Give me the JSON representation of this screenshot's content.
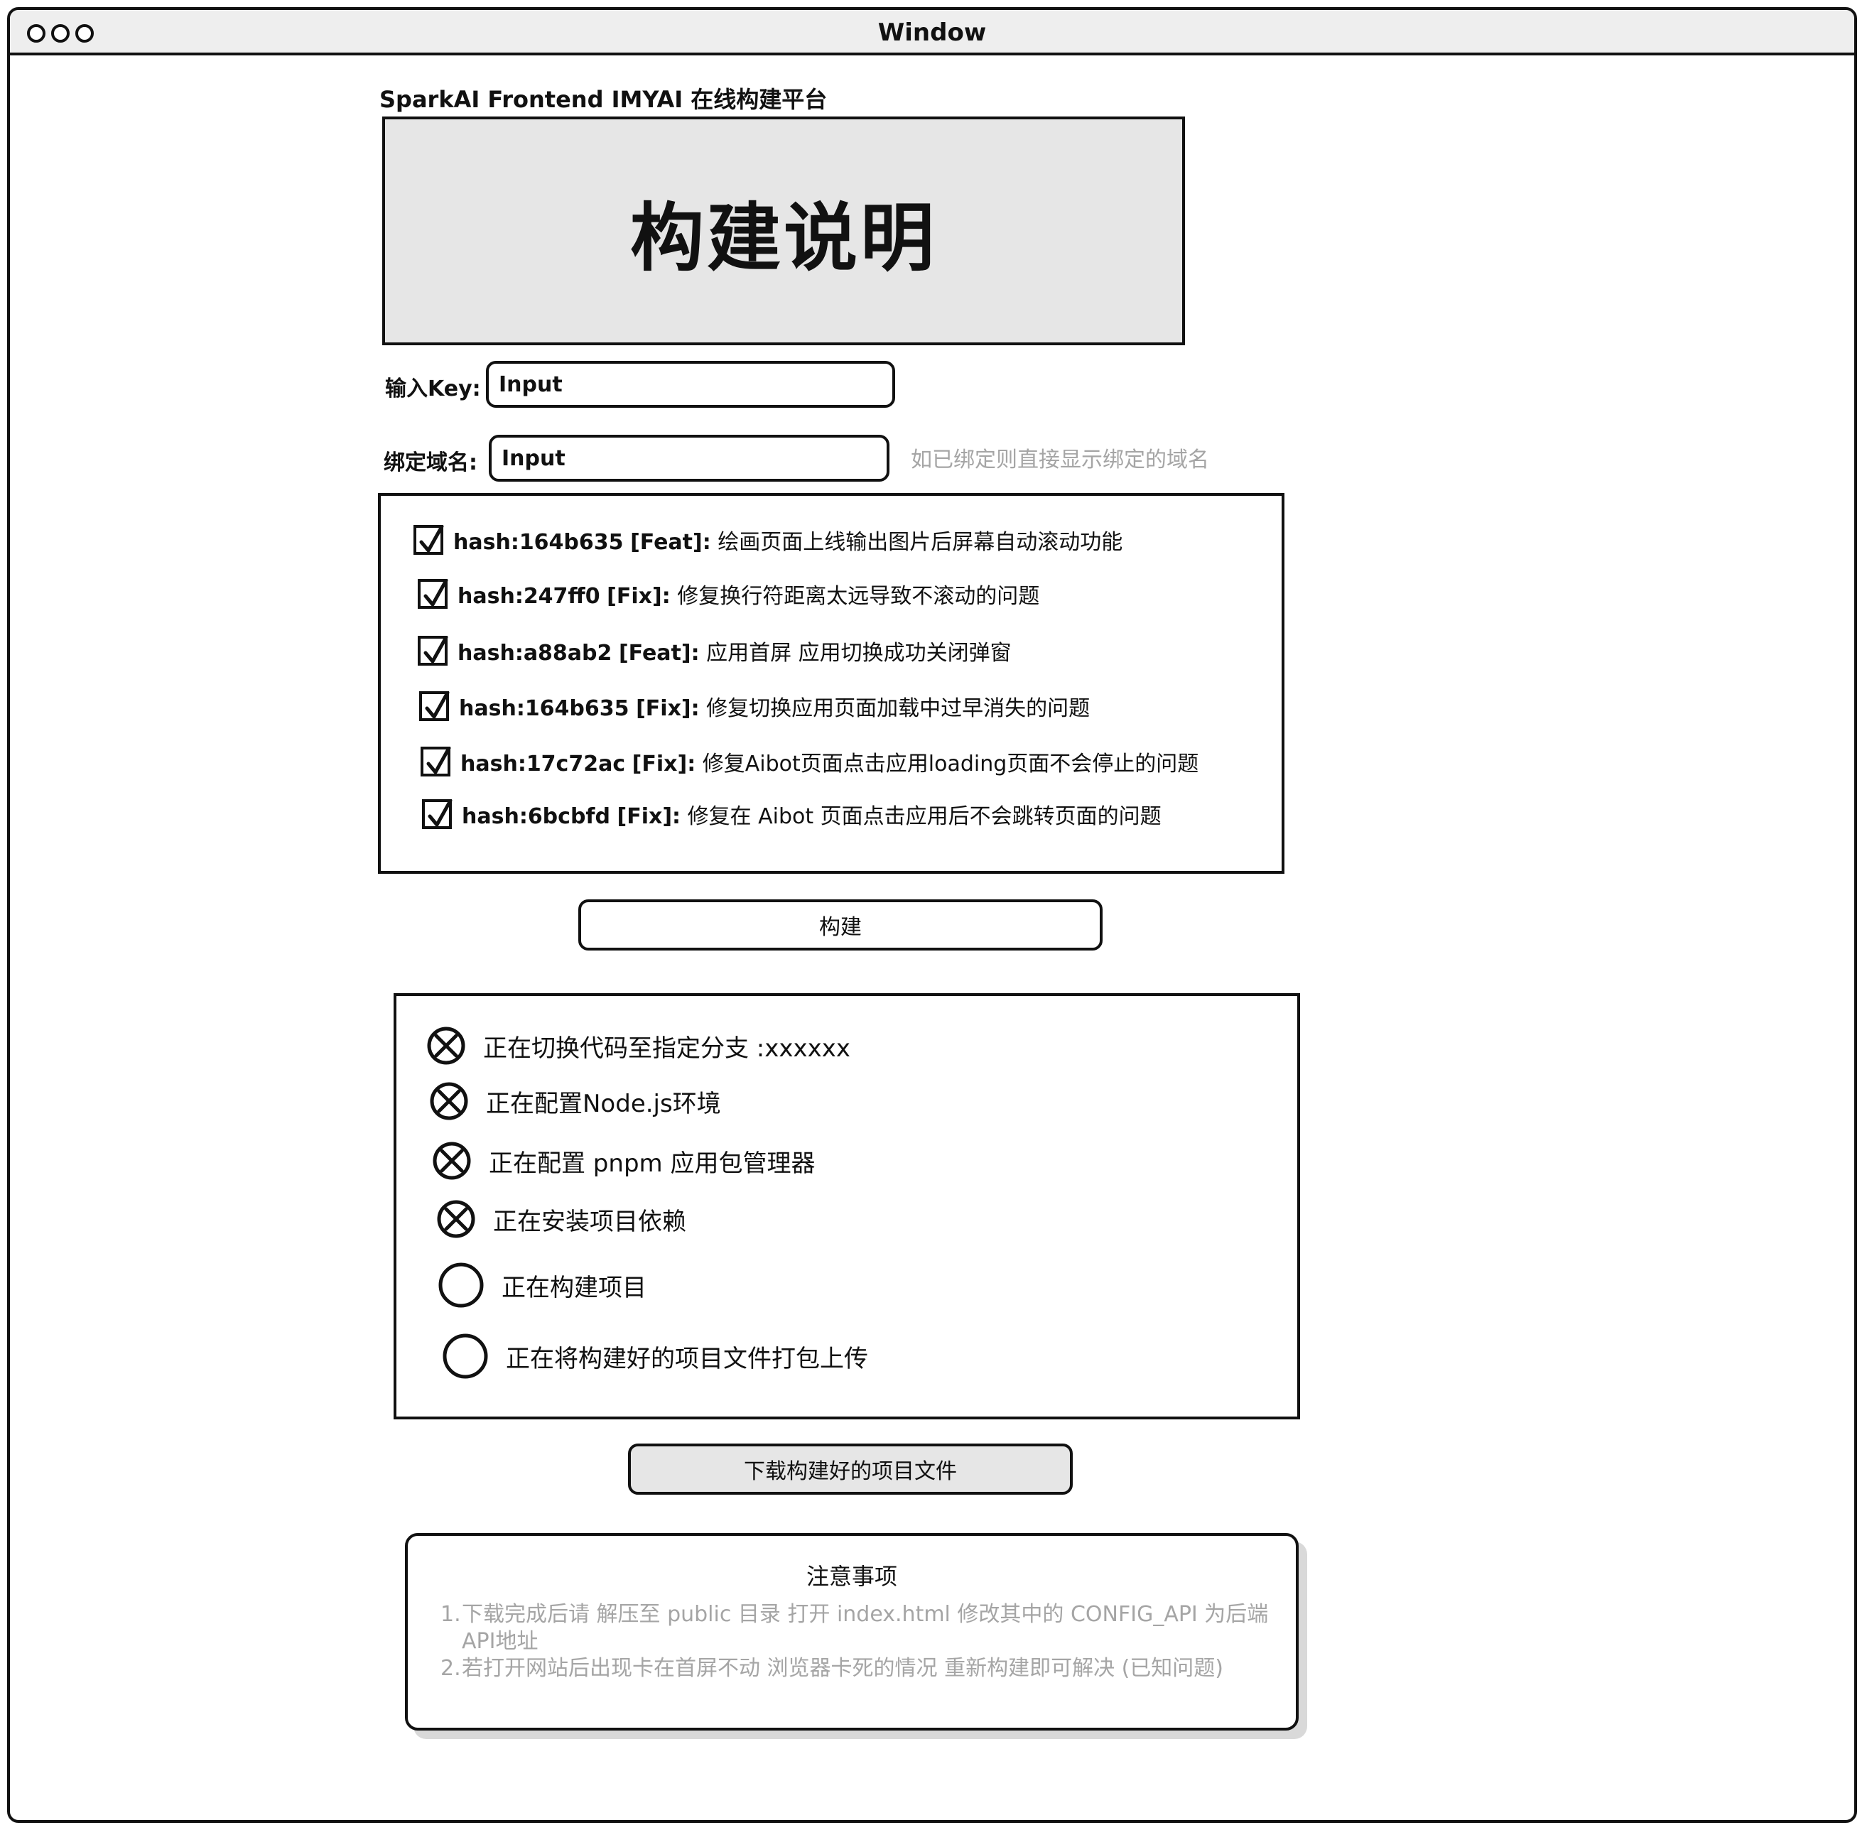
{
  "window": {
    "title": "Window"
  },
  "app": {
    "title": "SparkAI Frontend IMYAI 在线构建平台"
  },
  "hero": {
    "title": "构建说明"
  },
  "form": {
    "key_label": "输入Key:",
    "key_placeholder": "Input",
    "domain_label": "绑定域名:",
    "domain_placeholder": "Input",
    "domain_hint": "如已绑定则直接显示绑定的域名"
  },
  "commits": [
    {
      "hash": "hash:164b635",
      "type": "[Feat]:",
      "message": "绘画页面上线输出图片后屏幕自动滚动功能",
      "checked": true
    },
    {
      "hash": "hash:247ff0",
      "type": "[Fix]:",
      "message": "修复换行符距离太远导致不滚动的问题",
      "checked": true
    },
    {
      "hash": "hash:a88ab2",
      "type": "[Feat]:",
      "message": "应用首屏 应用切换成功关闭弹窗",
      "checked": true
    },
    {
      "hash": "hash:164b635",
      "type": "[Fix]:",
      "message": "修复切换应用页面加载中过早消失的问题",
      "checked": true
    },
    {
      "hash": "hash:17c72ac",
      "type": "[Fix]:",
      "message": "修复Aibot页面点击应用loading页面不会停止的问题",
      "checked": true
    },
    {
      "hash": "hash:6bcbfd",
      "type": "[Fix]:",
      "message": "修复在 Aibot 页面点击应用后不会跳转页面的问题",
      "checked": true
    }
  ],
  "build_button": "构建",
  "steps": [
    {
      "label": "正在切换代码至指定分支 :xxxxxx",
      "status": "failed"
    },
    {
      "label": "正在配置Node.js环境",
      "status": "failed"
    },
    {
      "label": "正在配置 pnpm 应用包管理器",
      "status": "failed"
    },
    {
      "label": "正在安装项目依赖",
      "status": "failed"
    },
    {
      "label": "正在构建项目",
      "status": "pending"
    },
    {
      "label": "正在将构建好的项目文件打包上传",
      "status": "pending"
    }
  ],
  "download_button": "下载构建好的项目文件",
  "notice": {
    "title": "注意事项",
    "items": [
      {
        "num": "1.",
        "text": "下载完成后请 解压至 public 目录 打开 index.html 修改其中的 CONFIG_API 为后端 API地址"
      },
      {
        "num": "2.",
        "text": "若打开网站后出现卡在首屏不动 浏览器卡死的情况 重新构建即可解决 (已知问题)"
      }
    ]
  }
}
